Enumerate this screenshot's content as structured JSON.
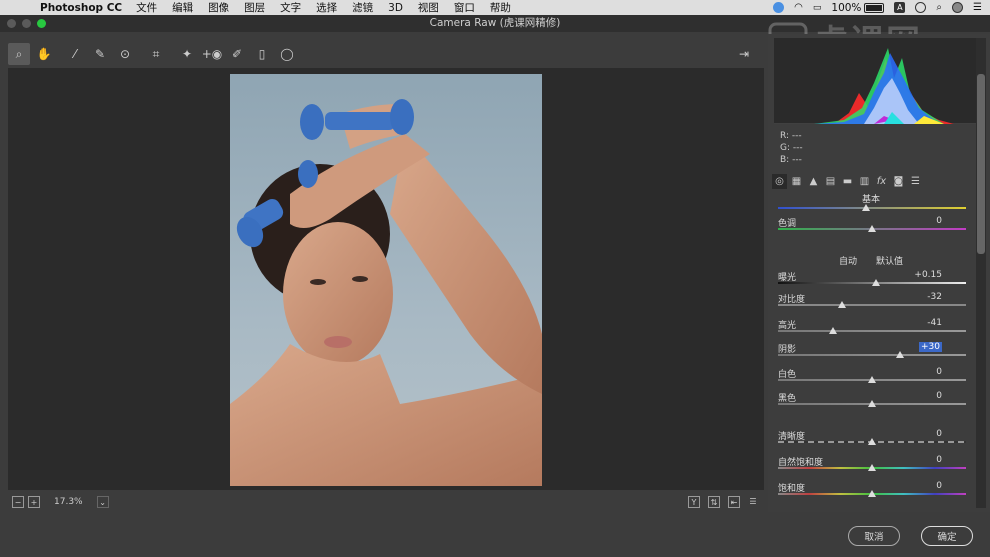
{
  "menubar": {
    "app_name": "Photoshop CC",
    "items": [
      "文件",
      "编辑",
      "图像",
      "图层",
      "文字",
      "选择",
      "滤镜",
      "3D",
      "视图",
      "窗口",
      "帮助"
    ],
    "battery": "100%",
    "icons": [
      "apple-icon",
      "app-icon",
      "wifi-icon",
      "airplay-icon",
      "battery-icon",
      "input-a-icon",
      "clock-icon",
      "search-icon",
      "user-icon",
      "list-icon"
    ]
  },
  "window": {
    "title": "Camera Raw (虎课网精修)"
  },
  "toolbar": {
    "tools": [
      "zoom",
      "hand",
      "white-balance",
      "color-sampler",
      "target-adjust",
      "crop",
      "spot-removal",
      "red-eye",
      "brush",
      "graduated-filter",
      "radial-filter"
    ],
    "active": "zoom"
  },
  "watermark": "虎课网",
  "status": {
    "zoom": "17.3%"
  },
  "rgb_readout": {
    "r_label": "R:",
    "r_val": "---",
    "g_label": "G:",
    "g_val": "---",
    "b_label": "B:",
    "b_val": "---"
  },
  "panel": {
    "title": "基本",
    "auto_label": "自动",
    "default_label": "默认值",
    "sliders": [
      {
        "label": "色调",
        "value": "0",
        "pos": 0.5,
        "track": "tint"
      },
      {
        "label": "曝光",
        "value": "+0.15",
        "pos": 0.52,
        "track": "exposure"
      },
      {
        "label": "对比度",
        "value": "-32",
        "pos": 0.34,
        "track": "contrast"
      },
      {
        "label": "高光",
        "value": "-41",
        "pos": 0.29,
        "track": "gray"
      },
      {
        "label": "阴影",
        "value": "+30",
        "pos": 0.65,
        "track": "gray",
        "selected": true
      },
      {
        "label": "白色",
        "value": "0",
        "pos": 0.5,
        "track": "gray"
      },
      {
        "label": "黑色",
        "value": "0",
        "pos": 0.5,
        "track": "gray"
      },
      {
        "label": "清晰度",
        "value": "0",
        "pos": 0.5,
        "track": "dashed"
      },
      {
        "label": "自然饱和度",
        "value": "0",
        "pos": 0.5,
        "track": "rainbow"
      },
      {
        "label": "饱和度",
        "value": "0",
        "pos": 0.5,
        "track": "rainbow"
      }
    ]
  },
  "buttons": {
    "cancel": "取消",
    "ok": "确定"
  },
  "colors": {
    "accent": "#3b68c7",
    "bg": "#3c3c3c",
    "canvas": "#2b2b2b"
  }
}
